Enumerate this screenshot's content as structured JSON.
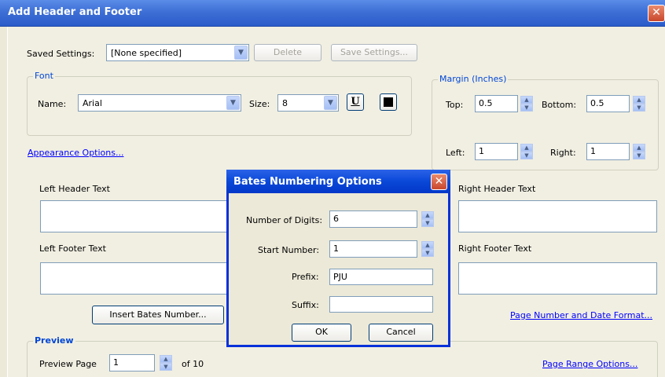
{
  "window": {
    "title": "Add Header and Footer",
    "close_glyph": "✕"
  },
  "saved_settings": {
    "label": "Saved Settings:",
    "value": "[None specified]",
    "delete_label": "Delete",
    "save_label": "Save Settings..."
  },
  "font": {
    "group_title": "Font",
    "name_label": "Name:",
    "name_value": "Arial",
    "size_label": "Size:",
    "size_value": "8",
    "underline_glyph": "U"
  },
  "margin": {
    "group_title": "Margin (Inches)",
    "top_label": "Top:",
    "top_value": "0.5",
    "bottom_label": "Bottom:",
    "bottom_value": "0.5",
    "left_label": "Left:",
    "left_value": "1",
    "right_label": "Right:",
    "right_value": "1"
  },
  "appearance_link": "Appearance Options...",
  "text_areas": {
    "left_header": "Left Header Text",
    "right_header": "Right Header Text",
    "left_footer": "Left Footer Text",
    "right_footer": "Right Footer Text"
  },
  "insert_bates_label": "Insert Bates Number...",
  "page_number_link": "Page Number and Date Format...",
  "preview": {
    "group_title": "Preview",
    "page_label": "Preview Page",
    "page_value": "1",
    "of_text": "of 10",
    "range_link": "Page Range Options..."
  },
  "bates_dialog": {
    "title": "Bates Numbering Options",
    "close_glyph": "✕",
    "digits_label": "Number of Digits:",
    "digits_value": "6",
    "start_label": "Start Number:",
    "start_value": "1",
    "prefix_label": "Prefix:",
    "prefix_value": "PJU",
    "suffix_label": "Suffix:",
    "suffix_value": "",
    "ok_label": "OK",
    "cancel_label": "Cancel"
  },
  "icons": {
    "dropdown_arrow": "chevron-down-icon",
    "spin_up": "chevron-up-icon",
    "spin_down": "chevron-down-icon"
  },
  "colors": {
    "title_bar": "#3E6FD6",
    "group_title": "#0046D5",
    "link": "#0000FF",
    "dialog_bg": "#F1EFE2"
  }
}
